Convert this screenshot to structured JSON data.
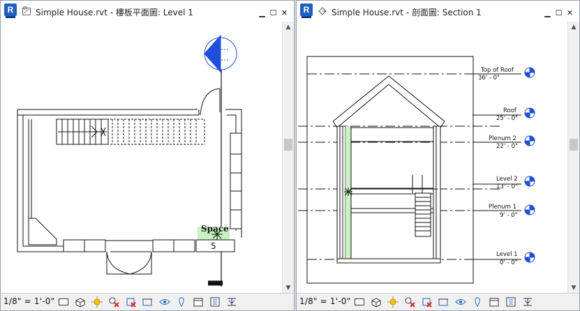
{
  "left_window": {
    "app_icon_letter": "R",
    "title": "Simple House.rvt - 樓板平面圖: Level 1",
    "scale": "1/8\" = 1'-0\"",
    "space_tag": "Space",
    "space_number": "5"
  },
  "right_window": {
    "app_icon_letter": "R",
    "title": "Simple House.rvt - 剖面圖: Section 1",
    "scale": "1/8\" = 1'-0\"",
    "levels": [
      {
        "name": "Top of Roof",
        "elevation": "36' - 0\""
      },
      {
        "name": "Roof",
        "elevation": "25' - 0\""
      },
      {
        "name": "Plenum 2",
        "elevation": "22' - 0\""
      },
      {
        "name": "Level 2",
        "elevation": "13' - 0\""
      },
      {
        "name": "Plenum 1",
        "elevation": "9' - 0\""
      },
      {
        "name": "Level 1",
        "elevation": "0' - 0\""
      }
    ]
  },
  "window_controls": {
    "minimize": "▁",
    "maximize": "☐",
    "close": "✕"
  },
  "scroll": {
    "up": "▲",
    "down": "▼"
  },
  "colors": {
    "revit_blue": "#1f5fbf",
    "section_marker": "#1f4fd8",
    "space_fill": "#c9f0c2"
  }
}
